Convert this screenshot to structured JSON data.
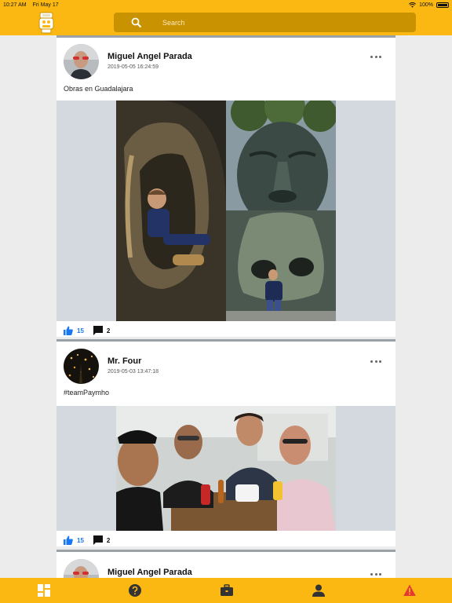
{
  "status_bar": {
    "time": "10:27 AM",
    "date": "Fri May 17",
    "battery": "100%"
  },
  "header": {
    "logo": "paymo-mascot-logo",
    "search": {
      "placeholder": "Search",
      "value": ""
    }
  },
  "colors": {
    "brand": "#fbb813",
    "search_bg": "#c99200",
    "like": "#1877f2",
    "alert": "#e53935"
  },
  "posts": [
    {
      "author": "Miguel Angel Parada",
      "timestamp": "2019-05-05 16:24:59",
      "caption": "Obras en Guadalajara",
      "likes": "15",
      "comments": "2",
      "images": [
        "photo-ear-sculpture-child",
        "photo-face-sculpture",
        "photo-nose-sculpture-child"
      ]
    },
    {
      "author": "Mr. Four",
      "timestamp": "2019-05-03 13:47:18",
      "caption": "#teamPaymho",
      "likes": "15",
      "comments": "2",
      "images": [
        "photo-group-selfie"
      ]
    },
    {
      "author": "Miguel Angel Parada",
      "timestamp": "",
      "caption": "",
      "likes": "",
      "comments": "",
      "images": []
    }
  ],
  "bottom_nav": [
    "grid-icon",
    "help-icon",
    "briefcase-icon",
    "user-icon",
    "warning-icon"
  ]
}
